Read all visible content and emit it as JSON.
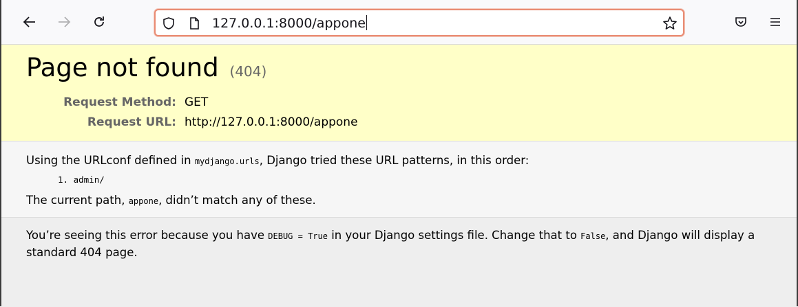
{
  "browser": {
    "url": "127.0.0.1:8000/appone"
  },
  "page": {
    "title": "Page not found",
    "status_code": "(404)",
    "request_method_label": "Request Method:",
    "request_method": "GET",
    "request_url_label": "Request URL:",
    "request_url": "http://127.0.0.1:8000/appone",
    "urlconf_prefix": "Using the URLconf defined in ",
    "urlconf_name": "mydjango.urls",
    "urlconf_suffix": ", Django tried these URL patterns, in this order:",
    "patterns": [
      {
        "number": "1.",
        "pattern": "admin/"
      }
    ],
    "current_path_prefix": "The current path, ",
    "current_path": "appone",
    "current_path_suffix": ", didn’t match any of these.",
    "debug_prefix": "You’re seeing this error because you have ",
    "debug_setting": "DEBUG = True",
    "debug_middle": " in your Django settings file. Change that to ",
    "debug_false": "False",
    "debug_suffix": ", and Django will display a standard 404 page."
  }
}
